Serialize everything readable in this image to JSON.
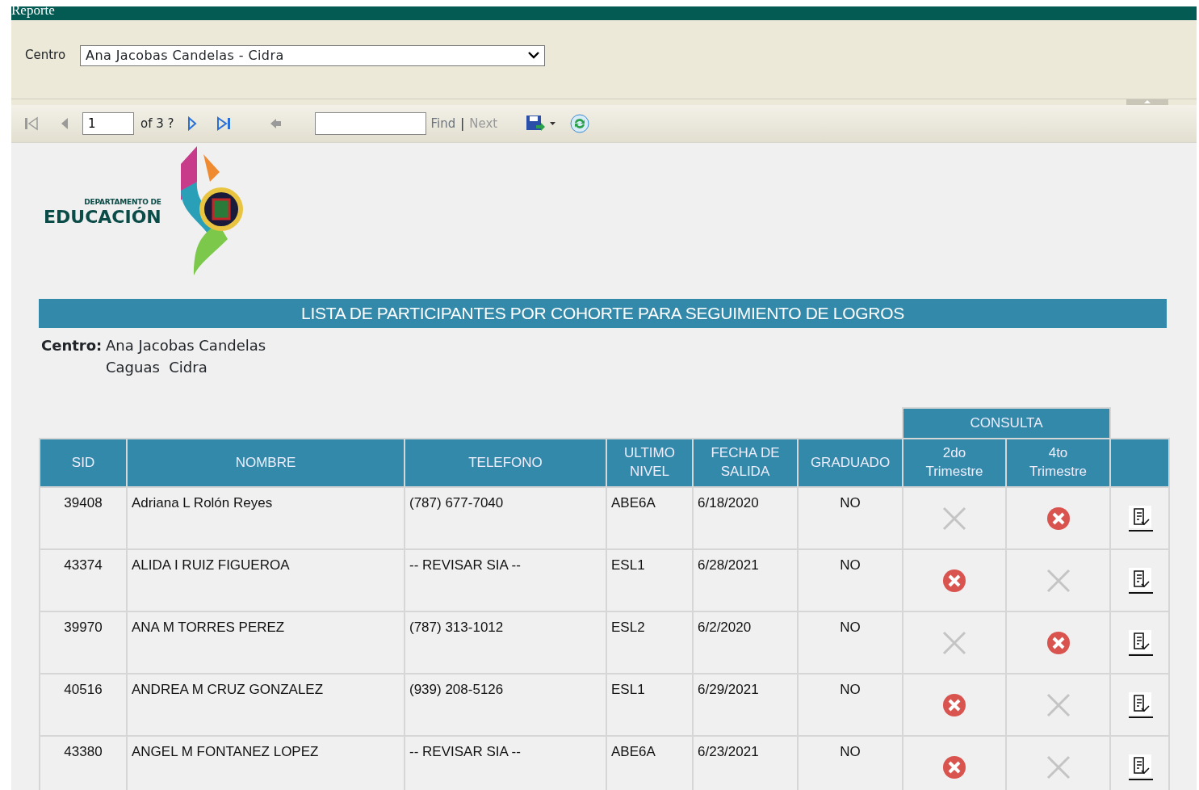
{
  "window": {
    "title": "Reporte"
  },
  "parameters": {
    "label": "Centro",
    "value": "Ana Jacobas Candelas - Cidra"
  },
  "toolbar": {
    "page": "1",
    "page_count": "of 3 ?",
    "find": "Find",
    "separator": "|",
    "next": "Next",
    "first_disabled": true,
    "prev_disabled": true,
    "next_disabled": false,
    "last_disabled": false,
    "back_disabled": true
  },
  "report": {
    "logo": {
      "line1": "DEPARTAMENTO DE",
      "line2": "EDUCACIÓN"
    },
    "title": "LISTA DE PARTICIPANTES POR COHORTE PARA SEGUIMIENTO DE LOGROS",
    "centro_label": "Centro:",
    "centro_lines": [
      "Ana Jacobas Candelas",
      "Caguas  Cidra"
    ],
    "group_header": "CONSULTA",
    "columns": [
      "SID",
      "NOMBRE",
      "TELEFONO",
      "ULTIMO NIVEL",
      "FECHA DE SALIDA",
      "GRADUADO",
      "2do Trimestre",
      "4to Trimestre"
    ],
    "rows": [
      {
        "sid": "39408",
        "nombre": "Adriana L Rolón Reyes",
        "telefono": "(787) 677-7040",
        "nivel": "ABE6A",
        "fecha": "6/18/2020",
        "graduado": "NO",
        "q2": {
          "kind": "cross"
        },
        "q4": {
          "kind": "error"
        }
      },
      {
        "sid": "43374",
        "nombre": "ALIDA I RUIZ FIGUEROA",
        "telefono": "-- REVISAR SIA --",
        "nivel": "ESL1",
        "fecha": "6/28/2021",
        "graduado": "NO",
        "q2": {
          "kind": "error"
        },
        "q4": {
          "kind": "cross"
        }
      },
      {
        "sid": "39970",
        "nombre": "ANA M TORRES PEREZ",
        "telefono": "(787) 313-1012",
        "nivel": "ESL2",
        "fecha": "6/2/2020",
        "graduado": "NO",
        "q2": {
          "kind": "cross"
        },
        "q4": {
          "kind": "error"
        }
      },
      {
        "sid": "40516",
        "nombre": "ANDREA M CRUZ GONZALEZ",
        "telefono": "(939) 208-5126",
        "nivel": "ESL1",
        "fecha": "6/29/2021",
        "graduado": "NO",
        "q2": {
          "kind": "error"
        },
        "q4": {
          "kind": "cross"
        }
      },
      {
        "sid": "43380",
        "nombre": "ANGEL M FONTANEZ LOPEZ",
        "telefono": "-- REVISAR SIA --",
        "nivel": "ABE6A",
        "fecha": "6/23/2021",
        "graduado": "NO",
        "q2": {
          "kind": "error"
        },
        "q4": {
          "kind": "cross"
        }
      }
    ]
  }
}
